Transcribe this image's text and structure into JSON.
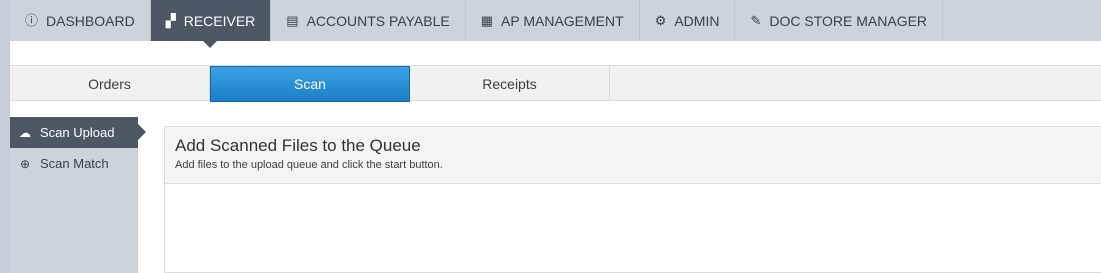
{
  "topnav": {
    "items": [
      {
        "label": "DASHBOARD",
        "icon": "info-circle-icon"
      },
      {
        "label": "RECEIVER",
        "icon": "boxes-icon",
        "active": true
      },
      {
        "label": "ACCOUNTS PAYABLE",
        "icon": "document-dollar-icon"
      },
      {
        "label": "AP MANAGEMENT",
        "icon": "building-icon"
      },
      {
        "label": "ADMIN",
        "icon": "gear-icon"
      },
      {
        "label": "DOC STORE MANAGER",
        "icon": "edit-icon"
      }
    ]
  },
  "subtabs": {
    "items": [
      {
        "label": "Orders"
      },
      {
        "label": "Scan",
        "active": true
      },
      {
        "label": "Receipts"
      }
    ]
  },
  "sidebar": {
    "items": [
      {
        "label": "Scan Upload",
        "icon": "cloud-upload-icon",
        "active": true
      },
      {
        "label": "Scan Match",
        "icon": "lifebuoy-icon"
      }
    ]
  },
  "panel": {
    "title": "Add Scanned Files to the Queue",
    "subtitle": "Add files to the upload queue and click the start button."
  },
  "colors": {
    "nav_bg": "#ccd3da",
    "nav_active": "#4d5864",
    "tab_active": "#1b7fc7"
  }
}
